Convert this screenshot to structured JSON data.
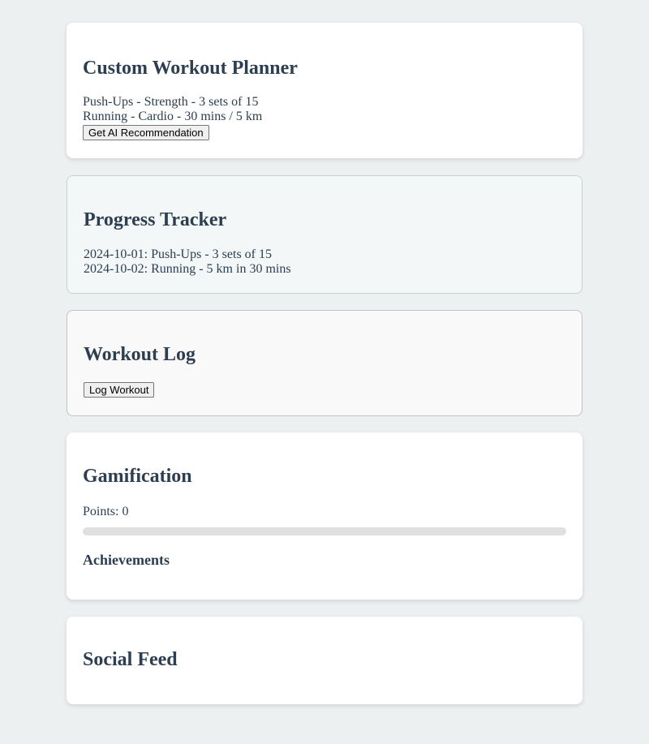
{
  "planner": {
    "title": "Custom Workout Planner",
    "workouts": [
      "Push-Ups - Strength - 3 sets of 15",
      "Running - Cardio - 30 mins / 5 km"
    ],
    "ai_button_label": "Get AI Recommendation"
  },
  "progress": {
    "title": "Progress Tracker",
    "entries": [
      "2024-10-01: Push-Ups - 3 sets of 15",
      "2024-10-02: Running - 5 km in 30 mins"
    ]
  },
  "log": {
    "title": "Workout Log",
    "button_label": "Log Workout"
  },
  "gamification": {
    "title": "Gamification",
    "points_text": "Points: 0",
    "points_progress": 0,
    "achievements_title": "Achievements"
  },
  "social": {
    "title": "Social Feed"
  }
}
